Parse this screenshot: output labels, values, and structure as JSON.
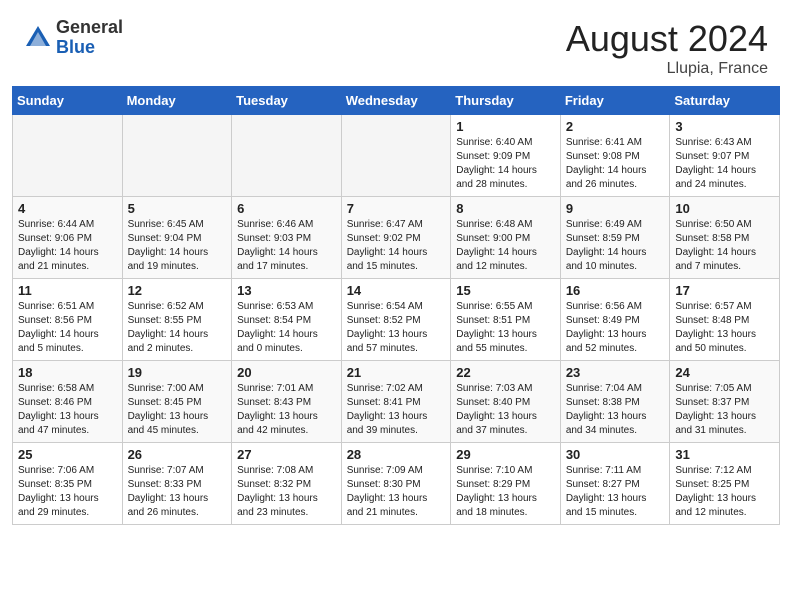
{
  "header": {
    "logo_general": "General",
    "logo_blue": "Blue",
    "month_year": "August 2024",
    "location": "Llupia, France"
  },
  "weekdays": [
    "Sunday",
    "Monday",
    "Tuesday",
    "Wednesday",
    "Thursday",
    "Friday",
    "Saturday"
  ],
  "weeks": [
    [
      {
        "day": "",
        "empty": true
      },
      {
        "day": "",
        "empty": true
      },
      {
        "day": "",
        "empty": true
      },
      {
        "day": "",
        "empty": true
      },
      {
        "day": "1",
        "sunrise": "Sunrise: 6:40 AM",
        "sunset": "Sunset: 9:09 PM",
        "daylight": "Daylight: 14 hours and 28 minutes."
      },
      {
        "day": "2",
        "sunrise": "Sunrise: 6:41 AM",
        "sunset": "Sunset: 9:08 PM",
        "daylight": "Daylight: 14 hours and 26 minutes."
      },
      {
        "day": "3",
        "sunrise": "Sunrise: 6:43 AM",
        "sunset": "Sunset: 9:07 PM",
        "daylight": "Daylight: 14 hours and 24 minutes."
      }
    ],
    [
      {
        "day": "4",
        "sunrise": "Sunrise: 6:44 AM",
        "sunset": "Sunset: 9:06 PM",
        "daylight": "Daylight: 14 hours and 21 minutes."
      },
      {
        "day": "5",
        "sunrise": "Sunrise: 6:45 AM",
        "sunset": "Sunset: 9:04 PM",
        "daylight": "Daylight: 14 hours and 19 minutes."
      },
      {
        "day": "6",
        "sunrise": "Sunrise: 6:46 AM",
        "sunset": "Sunset: 9:03 PM",
        "daylight": "Daylight: 14 hours and 17 minutes."
      },
      {
        "day": "7",
        "sunrise": "Sunrise: 6:47 AM",
        "sunset": "Sunset: 9:02 PM",
        "daylight": "Daylight: 14 hours and 15 minutes."
      },
      {
        "day": "8",
        "sunrise": "Sunrise: 6:48 AM",
        "sunset": "Sunset: 9:00 PM",
        "daylight": "Daylight: 14 hours and 12 minutes."
      },
      {
        "day": "9",
        "sunrise": "Sunrise: 6:49 AM",
        "sunset": "Sunset: 8:59 PM",
        "daylight": "Daylight: 14 hours and 10 minutes."
      },
      {
        "day": "10",
        "sunrise": "Sunrise: 6:50 AM",
        "sunset": "Sunset: 8:58 PM",
        "daylight": "Daylight: 14 hours and 7 minutes."
      }
    ],
    [
      {
        "day": "11",
        "sunrise": "Sunrise: 6:51 AM",
        "sunset": "Sunset: 8:56 PM",
        "daylight": "Daylight: 14 hours and 5 minutes."
      },
      {
        "day": "12",
        "sunrise": "Sunrise: 6:52 AM",
        "sunset": "Sunset: 8:55 PM",
        "daylight": "Daylight: 14 hours and 2 minutes."
      },
      {
        "day": "13",
        "sunrise": "Sunrise: 6:53 AM",
        "sunset": "Sunset: 8:54 PM",
        "daylight": "Daylight: 14 hours and 0 minutes."
      },
      {
        "day": "14",
        "sunrise": "Sunrise: 6:54 AM",
        "sunset": "Sunset: 8:52 PM",
        "daylight": "Daylight: 13 hours and 57 minutes."
      },
      {
        "day": "15",
        "sunrise": "Sunrise: 6:55 AM",
        "sunset": "Sunset: 8:51 PM",
        "daylight": "Daylight: 13 hours and 55 minutes."
      },
      {
        "day": "16",
        "sunrise": "Sunrise: 6:56 AM",
        "sunset": "Sunset: 8:49 PM",
        "daylight": "Daylight: 13 hours and 52 minutes."
      },
      {
        "day": "17",
        "sunrise": "Sunrise: 6:57 AM",
        "sunset": "Sunset: 8:48 PM",
        "daylight": "Daylight: 13 hours and 50 minutes."
      }
    ],
    [
      {
        "day": "18",
        "sunrise": "Sunrise: 6:58 AM",
        "sunset": "Sunset: 8:46 PM",
        "daylight": "Daylight: 13 hours and 47 minutes."
      },
      {
        "day": "19",
        "sunrise": "Sunrise: 7:00 AM",
        "sunset": "Sunset: 8:45 PM",
        "daylight": "Daylight: 13 hours and 45 minutes."
      },
      {
        "day": "20",
        "sunrise": "Sunrise: 7:01 AM",
        "sunset": "Sunset: 8:43 PM",
        "daylight": "Daylight: 13 hours and 42 minutes."
      },
      {
        "day": "21",
        "sunrise": "Sunrise: 7:02 AM",
        "sunset": "Sunset: 8:41 PM",
        "daylight": "Daylight: 13 hours and 39 minutes."
      },
      {
        "day": "22",
        "sunrise": "Sunrise: 7:03 AM",
        "sunset": "Sunset: 8:40 PM",
        "daylight": "Daylight: 13 hours and 37 minutes."
      },
      {
        "day": "23",
        "sunrise": "Sunrise: 7:04 AM",
        "sunset": "Sunset: 8:38 PM",
        "daylight": "Daylight: 13 hours and 34 minutes."
      },
      {
        "day": "24",
        "sunrise": "Sunrise: 7:05 AM",
        "sunset": "Sunset: 8:37 PM",
        "daylight": "Daylight: 13 hours and 31 minutes."
      }
    ],
    [
      {
        "day": "25",
        "sunrise": "Sunrise: 7:06 AM",
        "sunset": "Sunset: 8:35 PM",
        "daylight": "Daylight: 13 hours and 29 minutes."
      },
      {
        "day": "26",
        "sunrise": "Sunrise: 7:07 AM",
        "sunset": "Sunset: 8:33 PM",
        "daylight": "Daylight: 13 hours and 26 minutes."
      },
      {
        "day": "27",
        "sunrise": "Sunrise: 7:08 AM",
        "sunset": "Sunset: 8:32 PM",
        "daylight": "Daylight: 13 hours and 23 minutes."
      },
      {
        "day": "28",
        "sunrise": "Sunrise: 7:09 AM",
        "sunset": "Sunset: 8:30 PM",
        "daylight": "Daylight: 13 hours and 21 minutes."
      },
      {
        "day": "29",
        "sunrise": "Sunrise: 7:10 AM",
        "sunset": "Sunset: 8:29 PM",
        "daylight": "Daylight: 13 hours and 18 minutes."
      },
      {
        "day": "30",
        "sunrise": "Sunrise: 7:11 AM",
        "sunset": "Sunset: 8:27 PM",
        "daylight": "Daylight: 13 hours and 15 minutes."
      },
      {
        "day": "31",
        "sunrise": "Sunrise: 7:12 AM",
        "sunset": "Sunset: 8:25 PM",
        "daylight": "Daylight: 13 hours and 12 minutes."
      }
    ]
  ]
}
